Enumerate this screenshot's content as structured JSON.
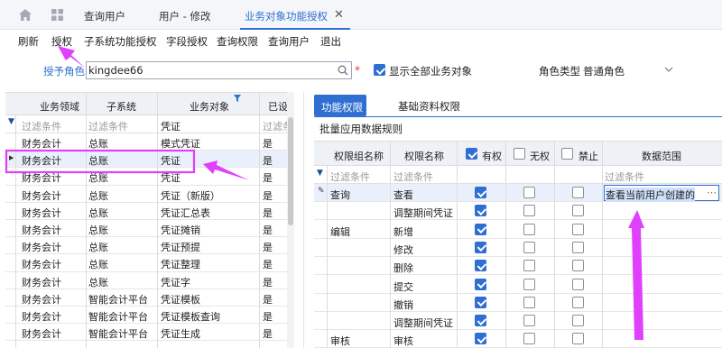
{
  "tabs": [
    {
      "label": "查询用户",
      "active": false
    },
    {
      "label": "用户 - 修改",
      "active": false
    },
    {
      "label": "业务对象功能授权",
      "active": true
    }
  ],
  "toolbar": [
    "刷新",
    "授权",
    "子系统功能授权",
    "字段授权",
    "查询权限",
    "查询用户",
    "退出"
  ],
  "form": {
    "role_label": "授予角色",
    "role_value": "kingdee66",
    "required_mark": "*",
    "show_all_label": "显示全部业务对象",
    "show_all_checked": true,
    "role_type_label": "角色类型",
    "role_type_value": "普通角色"
  },
  "left_grid": {
    "columns": [
      "业务领域",
      "子系统",
      "业务对象",
      "已设"
    ],
    "filter_label": "过滤条件",
    "filter_object_value": "凭证",
    "rows": [
      [
        "财务会计",
        "总账",
        "模式凭证",
        "是"
      ],
      [
        "财务会计",
        "总账",
        "凭证",
        "是"
      ],
      [
        "财务会计",
        "总账",
        "凭证",
        "是"
      ],
      [
        "财务会计",
        "总账",
        "凭证（新版）",
        "是"
      ],
      [
        "财务会计",
        "总账",
        "凭证汇总表",
        "是"
      ],
      [
        "财务会计",
        "总账",
        "凭证摊销",
        "是"
      ],
      [
        "财务会计",
        "总账",
        "凭证预提",
        "是"
      ],
      [
        "财务会计",
        "总账",
        "凭证整理",
        "是"
      ],
      [
        "财务会计",
        "总账",
        "凭证字",
        "是"
      ],
      [
        "财务会计",
        "智能会计平台",
        "凭证模板",
        "是"
      ],
      [
        "财务会计",
        "智能会计平台",
        "凭证模板查询",
        "是"
      ],
      [
        "财务会计",
        "智能会计平台",
        "凭证生成",
        "是"
      ]
    ],
    "selected_index": 1
  },
  "right_panel": {
    "tabs": [
      "功能权限",
      "基础资料权限"
    ],
    "active_tab": 0,
    "batch_label": "批量应用数据规则",
    "columns": {
      "group": "权限组名称",
      "name": "权限名称",
      "has": "有权",
      "none": "无权",
      "deny": "禁止",
      "range": "数据范围"
    },
    "header_checks": {
      "has": true,
      "none": false,
      "deny": false
    },
    "filter_label": "过滤条件",
    "rows": [
      {
        "group": "查询",
        "name": "查看",
        "has": true,
        "none": false,
        "deny": false,
        "range": "查看当前用户创建的",
        "editing": true
      },
      {
        "group": "",
        "name": "调整期间凭证",
        "has": true,
        "none": false,
        "deny": false,
        "range": ""
      },
      {
        "group": "编辑",
        "name": "新增",
        "has": true,
        "none": false,
        "deny": false,
        "range": ""
      },
      {
        "group": "",
        "name": "修改",
        "has": true,
        "none": false,
        "deny": false,
        "range": ""
      },
      {
        "group": "",
        "name": "删除",
        "has": true,
        "none": false,
        "deny": false,
        "range": ""
      },
      {
        "group": "",
        "name": "提交",
        "has": true,
        "none": false,
        "deny": false,
        "range": ""
      },
      {
        "group": "",
        "name": "撤销",
        "has": true,
        "none": false,
        "deny": false,
        "range": ""
      },
      {
        "group": "",
        "name": "调整期间凭证",
        "has": true,
        "none": false,
        "deny": false,
        "range": ""
      },
      {
        "group": "审核",
        "name": "审核",
        "has": true,
        "none": false,
        "deny": false,
        "range": ""
      }
    ]
  },
  "colors": {
    "accent": "#2f6fd1",
    "annotation": "#e040fb",
    "header_bg": "#eef1f6"
  },
  "annotations": [
    "arrow to 授权",
    "box around 财务会计/总账/凭证 row",
    "arrow to 凭证",
    "arrow to 数据范围 cell"
  ]
}
